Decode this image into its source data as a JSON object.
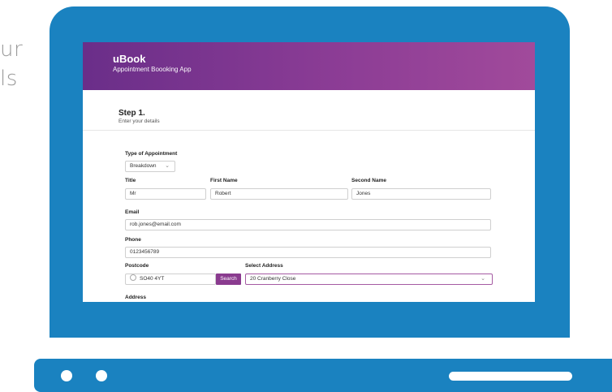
{
  "background": {
    "text_line1": "ur",
    "text_line2": "ls"
  },
  "app": {
    "name": "uBook",
    "tagline": "Appointment Boooking App"
  },
  "step": {
    "title": "Step 1.",
    "subtitle": "Enter your details"
  },
  "form": {
    "appointment_type": {
      "label": "Type of Appointment",
      "value": "Breakdown"
    },
    "title": {
      "label": "Title",
      "value": "Mr"
    },
    "first_name": {
      "label": "First Name",
      "value": "Robert"
    },
    "second_name": {
      "label": "Second Name",
      "value": "Jones"
    },
    "email": {
      "label": "Email",
      "value": "rob.jones@email.com"
    },
    "phone": {
      "label": "Phone",
      "value": "0123456789"
    },
    "postcode": {
      "label": "Postcode",
      "value": "SO40 4YT",
      "search_label": "Search"
    },
    "select_address": {
      "label": "Select Address",
      "value": "20 Cranberry Close"
    },
    "address": {
      "label": "Address"
    }
  },
  "colors": {
    "laptop": "#1a82c0",
    "header_start": "#6a2e89",
    "header_end": "#a14a9b",
    "accent": "#8a3b8f"
  }
}
